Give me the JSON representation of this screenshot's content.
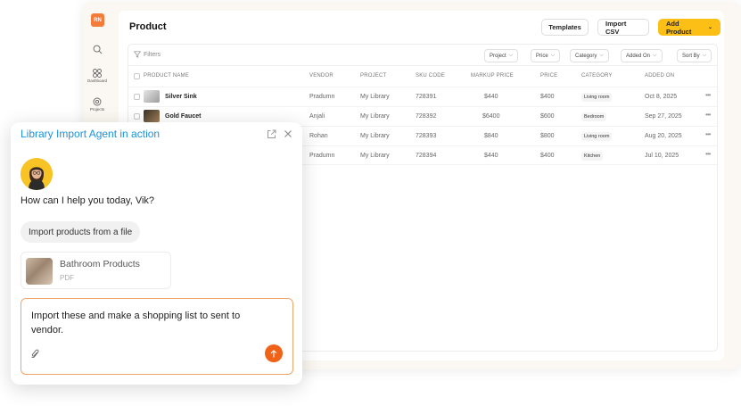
{
  "app": {
    "logo": "RN",
    "nav": [
      {
        "label": "",
        "icon": "search-icon"
      },
      {
        "label": "Dashboard",
        "icon": "dashboard-icon"
      },
      {
        "label": "Projects",
        "icon": "projects-icon"
      }
    ]
  },
  "header": {
    "title": "Product",
    "templates_label": "Templates",
    "import_label": "Import CSV",
    "add_label": "Add Product"
  },
  "filters": {
    "label": "Filters",
    "chips": [
      "Project",
      "Price",
      "Category",
      "Added On",
      "Sort By"
    ]
  },
  "table": {
    "headers": [
      "PRODUCT NAME",
      "VENDOR",
      "PROJECT",
      "SKU CODE",
      "MARKUP PRICE",
      "PRICE",
      "CATEGORY",
      "ADDED ON"
    ],
    "rows": [
      {
        "name": "Silver Sink",
        "vendor": "Pradumn",
        "project": "My Library",
        "sku": "728391",
        "markup": "$440",
        "price": "$400",
        "category": "Living room",
        "added": "Oct 8, 2025"
      },
      {
        "name": "Gold Faucet",
        "vendor": "Anjali",
        "project": "My Library",
        "sku": "728392",
        "markup": "$6400",
        "price": "$600",
        "category": "Bedroom",
        "added": "Sep 27, 2025"
      },
      {
        "name": "",
        "vendor": "Rohan",
        "project": "My Library",
        "sku": "728393",
        "markup": "$840",
        "price": "$800",
        "category": "Living room",
        "added": "Aug 20, 2025"
      },
      {
        "name": "",
        "vendor": "Pradumn",
        "project": "My Library",
        "sku": "728394",
        "markup": "$440",
        "price": "$400",
        "category": "Kitchen",
        "added": "Jul 10, 2025"
      }
    ]
  },
  "chat": {
    "title": "Library Import Agent in action",
    "greeting": "How can I help you today, Vik?",
    "suggestion": "Import products from a file",
    "file": {
      "name": "Bathroom Products",
      "type": "PDF"
    },
    "message": "Import these and make a shopping list to sent to vendor."
  },
  "colors": {
    "accent": "#f47b3a",
    "primary_button": "#fbbf16",
    "chat_title": "#1f92d9",
    "send": "#ef6217"
  }
}
